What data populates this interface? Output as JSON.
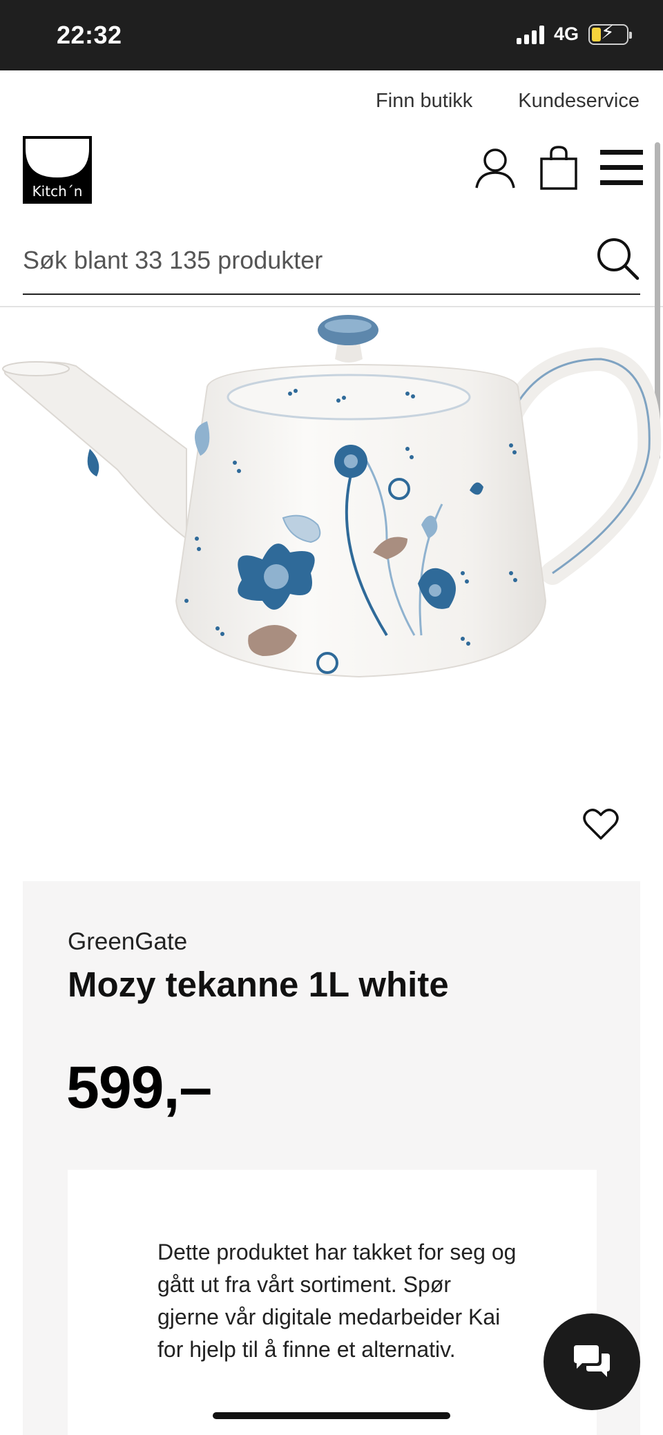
{
  "status_bar": {
    "time": "22:32",
    "network": "4G",
    "signal_icon": "signal-bars-icon",
    "battery_icon": "battery-charging-icon",
    "battery_level": 0.25
  },
  "top_links": {
    "find_store": "Finn butikk",
    "customer_service": "Kundeservice"
  },
  "header": {
    "logo_text": "Kitch´n",
    "icons": [
      "account-icon",
      "shopping-bag-icon",
      "hamburger-menu-icon"
    ]
  },
  "search": {
    "placeholder": "Søk blant 33 135 produkter",
    "icon": "search-icon"
  },
  "product": {
    "image_subject": "teapot",
    "favorite_icon": "heart-icon",
    "brand": "GreenGate",
    "title": "Mozy tekanne 1L white",
    "price": "599,–",
    "notice": "Dette produktet har takket for seg og gått ut fra vårt sortiment. Spør gjerne vår digitale medarbeider Kai for hjelp til å finne et alternativ."
  },
  "chat": {
    "icon": "chat-bubbles-icon"
  },
  "colors": {
    "status_bar_bg": "#1f1f1f",
    "panel_bg": "#f6f5f5",
    "chat_bg": "#1b1b1b",
    "pattern_blue": "#2f6a99",
    "pattern_light_blue": "#8fb2cf",
    "pattern_brown": "#a98e80"
  }
}
